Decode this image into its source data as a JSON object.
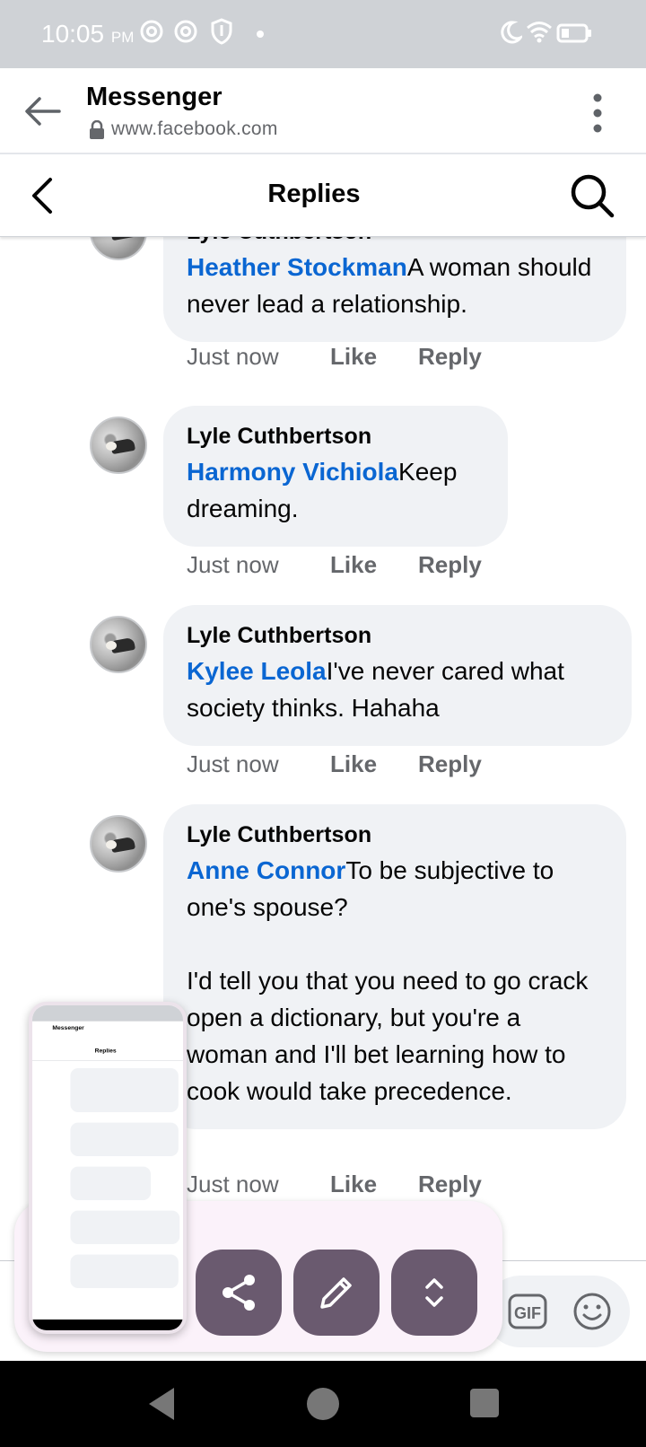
{
  "status_bar": {
    "time": "10:05",
    "ampm": "PM",
    "icons": [
      "chrome-icon",
      "chrome-icon",
      "shield-icon",
      "dot-icon",
      "moon-icon",
      "wifi-icon",
      "battery-icon"
    ]
  },
  "browser": {
    "title": "Messenger",
    "url": "www.facebook.com"
  },
  "header": {
    "title": "Replies"
  },
  "comments": [
    {
      "author": "Lyle Cuthbertson",
      "mention": "Heather Stockman",
      "text": "A woman should never lead a relationship.",
      "time": "Just now",
      "like": "Like",
      "reply": "Reply"
    },
    {
      "author": "Lyle Cuthbertson",
      "mention": "Harmony Vichiola",
      "text": "Keep dreaming.",
      "time": "Just now",
      "like": "Like",
      "reply": "Reply"
    },
    {
      "author": "Lyle Cuthbertson",
      "mention": "Kylee Leola",
      "text": "I've never cared what society thinks. Hahaha",
      "time": "Just now",
      "like": "Like",
      "reply": "Reply"
    },
    {
      "author": "Lyle Cuthbertson",
      "mention": "Anne Connor",
      "text": "To be subjective to one's spouse?\n\nI'd tell you that you need to go crack open a dictionary, but you're a woman and I'll bet learning how to cook would take precedence.",
      "time": "Just now",
      "like": "Like",
      "reply": "Reply"
    }
  ],
  "composer": {
    "icons": [
      "gif-icon",
      "emoji-icon"
    ]
  },
  "floating_actions": {
    "icons": [
      "share-icon",
      "edit-icon",
      "expand-icon"
    ]
  },
  "colors": {
    "accent_link": "#0a66d2",
    "bubble": "#f0f2f5",
    "meta_text": "#65676b",
    "float_button": "#6a5a6f"
  }
}
